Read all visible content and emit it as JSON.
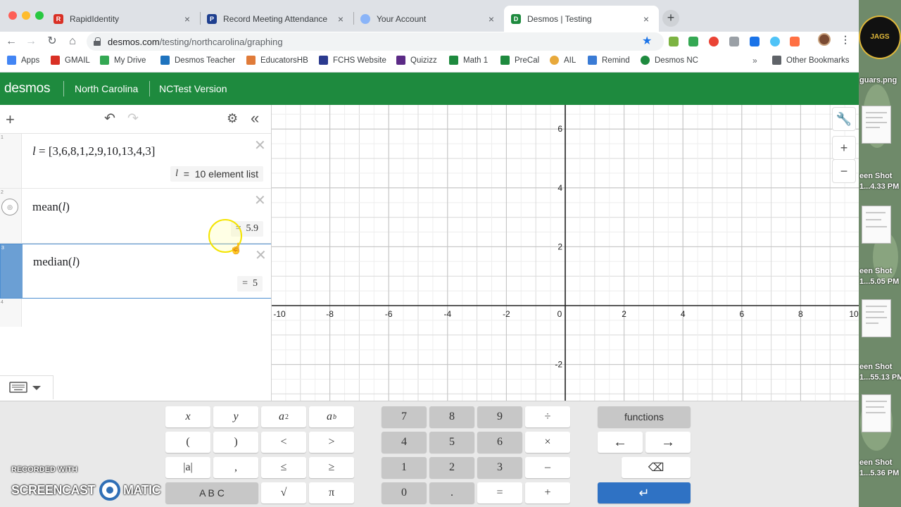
{
  "browser": {
    "tabs": [
      {
        "title": "RapidIdentity",
        "color": "#d93025",
        "glyph": "R"
      },
      {
        "title": "Record Meeting Attendance",
        "color": "#1e3f8f",
        "glyph": "P"
      },
      {
        "title": "Your Account",
        "color": "#8ab4f8",
        "glyph": ""
      },
      {
        "title": "Desmos | Testing",
        "color": "#1e8a3e",
        "glyph": "D"
      }
    ],
    "close_glyph": "×",
    "new_tab_glyph": "+",
    "url_host": "desmos.com",
    "url_path": "/testing/northcarolina/graphing",
    "bookmarks": [
      {
        "label": "Apps",
        "color": "#4285f4"
      },
      {
        "label": "GMAIL",
        "color": "#d93025"
      },
      {
        "label": "My Drive",
        "color": "#34a853"
      },
      {
        "label": "Desmos Teacher",
        "color": "#1e73be"
      },
      {
        "label": "EducatorsHB",
        "color": "#e07b39"
      },
      {
        "label": "FCHS Website",
        "color": "#2b3a8f"
      },
      {
        "label": "Quizizz",
        "color": "#5b2a86"
      },
      {
        "label": "Math 1",
        "color": "#1e8a3e"
      },
      {
        "label": "PreCal",
        "color": "#1e8a3e"
      },
      {
        "label": "AIL",
        "color": "#e8a93b"
      },
      {
        "label": "Remind",
        "color": "#3a7bd5"
      },
      {
        "label": "Desmos NC",
        "color": "#1e8a3e"
      }
    ],
    "bookmarks_more": "»",
    "other_bookmarks": "Other Bookmarks"
  },
  "desmos": {
    "logo": "desmos",
    "state": "North Carolina",
    "version": "NCTest Version",
    "brand_color": "#1e8a3e"
  },
  "expressions": [
    {
      "index": "1",
      "lhs": "l",
      "eq": " = ",
      "rhs": "[3,6,8,1,2,9,10,13,4,3]",
      "eval_var": "l",
      "eval_eq": "=",
      "eval_text": "10 element list"
    },
    {
      "index": "2",
      "func": "mean",
      "arg": "l",
      "eval_eq": "=",
      "eval_text": "5.9"
    },
    {
      "index": "3",
      "func": "median",
      "arg": "l",
      "eval_eq": "=",
      "eval_text": "5"
    },
    {
      "index": "4"
    }
  ],
  "graph": {
    "x_ticks": [
      "-10",
      "-8",
      "-6",
      "-4",
      "-2",
      "0",
      "2",
      "4",
      "6",
      "8",
      "10"
    ],
    "y_ticks": [
      "6",
      "4",
      "2",
      "-2"
    ]
  },
  "keypad": {
    "vars": [
      "x",
      "y",
      "a",
      "a",
      "(",
      ")",
      "<",
      ">",
      "|a|",
      ",",
      "≤",
      "≥",
      "A B C",
      "√",
      "π"
    ],
    "sup_a2": "2",
    "sup_ab": "b",
    "numbers": [
      "7",
      "8",
      "9",
      "÷",
      "4",
      "5",
      "6",
      "×",
      "1",
      "2",
      "3",
      "–",
      "0",
      ".",
      "=",
      "+"
    ],
    "functions": "functions",
    "left_arrow": "←",
    "right_arrow": "→",
    "backspace": "⌫",
    "enter": "↵"
  },
  "desktop": {
    "labels": [
      "guars.png",
      "een Shot",
      "1...4.33 PM",
      "een Shot",
      "1...5.05 PM",
      "een Shot",
      "1...55.13 PM",
      "een Shot",
      "1...5.36 PM"
    ]
  },
  "watermark": {
    "line1": "RECORDED WITH",
    "part1": "SCREENCAST",
    "part2": "MATIC"
  }
}
